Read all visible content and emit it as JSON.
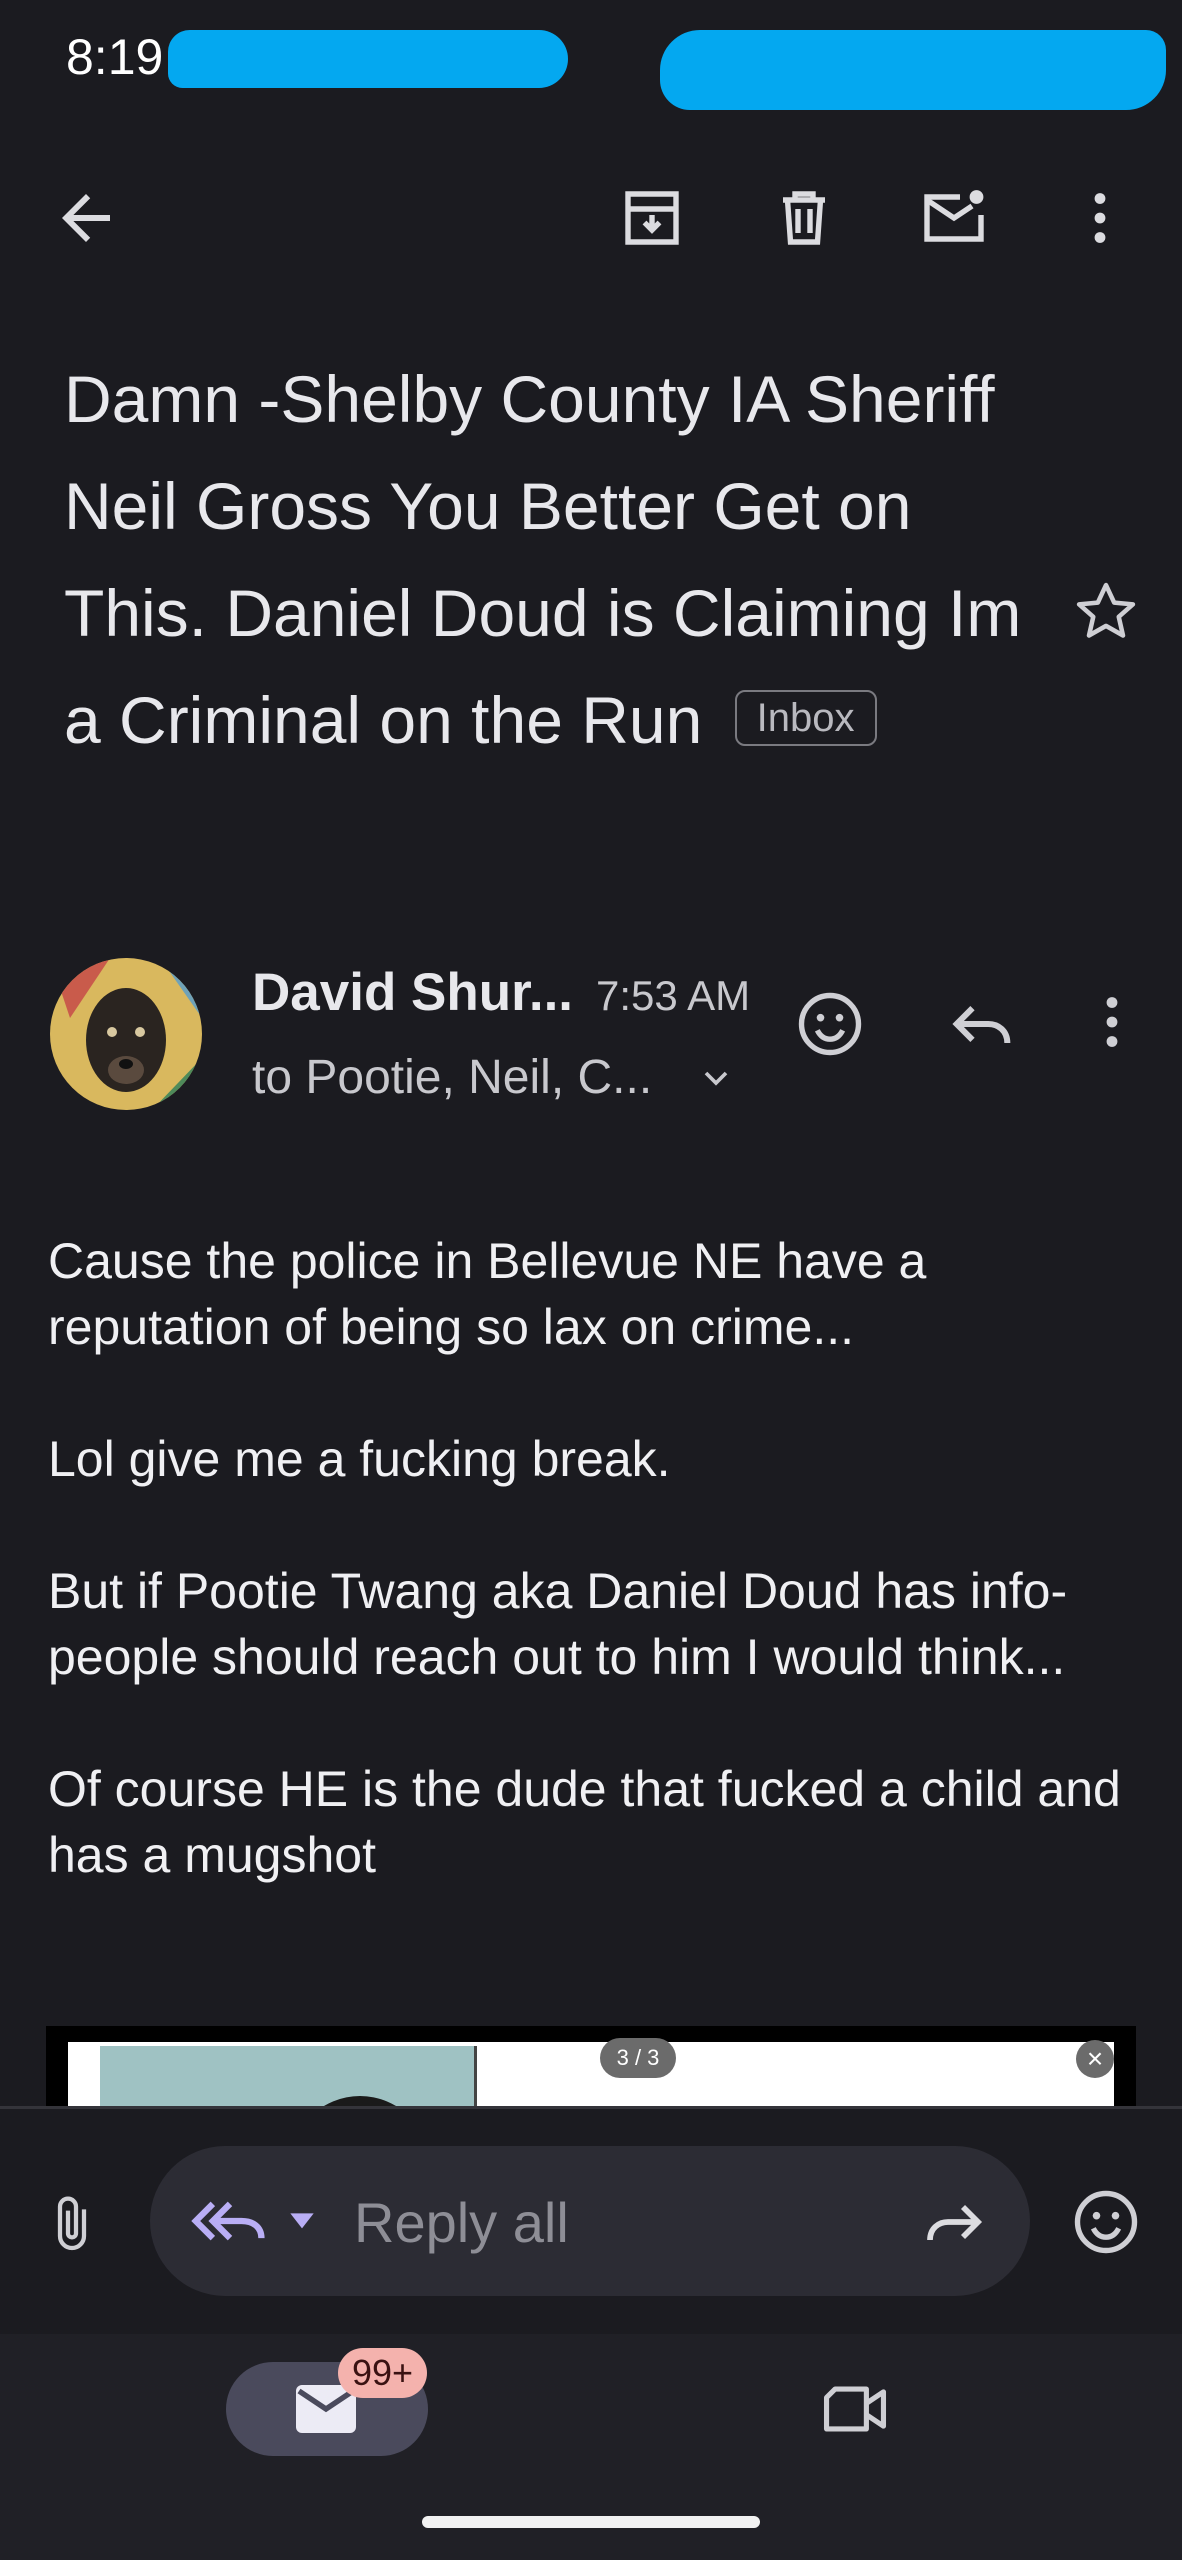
{
  "status_bar": {
    "time": "8:19"
  },
  "toolbar": {
    "back_icon": "arrow-left-icon",
    "archive_icon": "archive-icon",
    "delete_icon": "trash-icon",
    "mark_unread_icon": "mail-unread-icon",
    "more_icon": "more-vertical-icon"
  },
  "email": {
    "subject": "Damn -Shelby County IA Sheriff Neil Gross You Better Get on This. Daniel Doud is Claiming Im a Criminal on the Run",
    "label": "Inbox",
    "sender": {
      "name": "David Shur...",
      "time": "7:53 AM",
      "recipients": "to Pootie, Neil, C..."
    },
    "body": [
      "Cause the police in Bellevue NE have a reputation of being so lax on crime...",
      "Lol give me a fucking break.",
      "But if Pootie Twang aka Daniel Doud has info- people should reach out to him I would think...",
      "Of course HE is the dude that fucked a child and has a mugshot"
    ],
    "attachment": {
      "counter": "3 / 3",
      "close": "×"
    }
  },
  "reply_bar": {
    "placeholder": "Reply all"
  },
  "bottom_nav": {
    "mail_badge": "99+"
  },
  "colors": {
    "background": "#1b1b20",
    "accent": "#b9aef5",
    "badge": "#f4b2ad",
    "redaction": "#04a8f0"
  }
}
